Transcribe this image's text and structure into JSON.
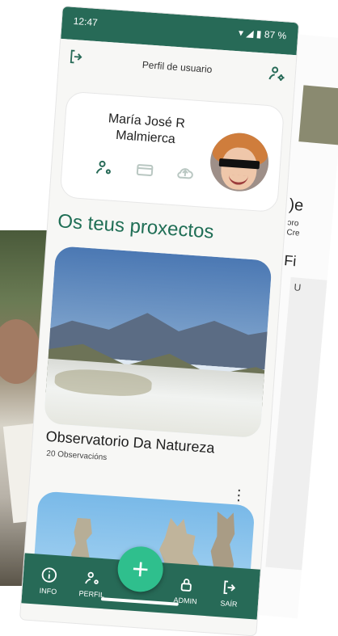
{
  "status_bar": {
    "time": "12:47",
    "battery": "87 %"
  },
  "header": {
    "title": "Perfil de usuario"
  },
  "profile": {
    "name_line1": "María José R",
    "name_line2": "Malmierca"
  },
  "section": {
    "title": "Os teus proxectos"
  },
  "projects": [
    {
      "title": "Observatorio Da Natureza",
      "count": "20 Observacións"
    }
  ],
  "bottom_nav": {
    "info": "INFO",
    "perfil": "PERFIL",
    "add": "+",
    "admin": "ADMIN",
    "sair": "SAÍR"
  },
  "background_screen": {
    "heading_fragment": ")e",
    "line1_fragment": "ɔro",
    "line2_fragment": "Cre",
    "section_fragment": "Fi",
    "panel_fragment": "U"
  },
  "icons": [
    "logout-icon",
    "user-settings-icon",
    "wallet-icon",
    "cloud-upload-icon",
    "info-icon",
    "plus-icon",
    "lock-icon"
  ],
  "colors": {
    "primary": "#276a57",
    "accent": "#2fbf8d"
  }
}
